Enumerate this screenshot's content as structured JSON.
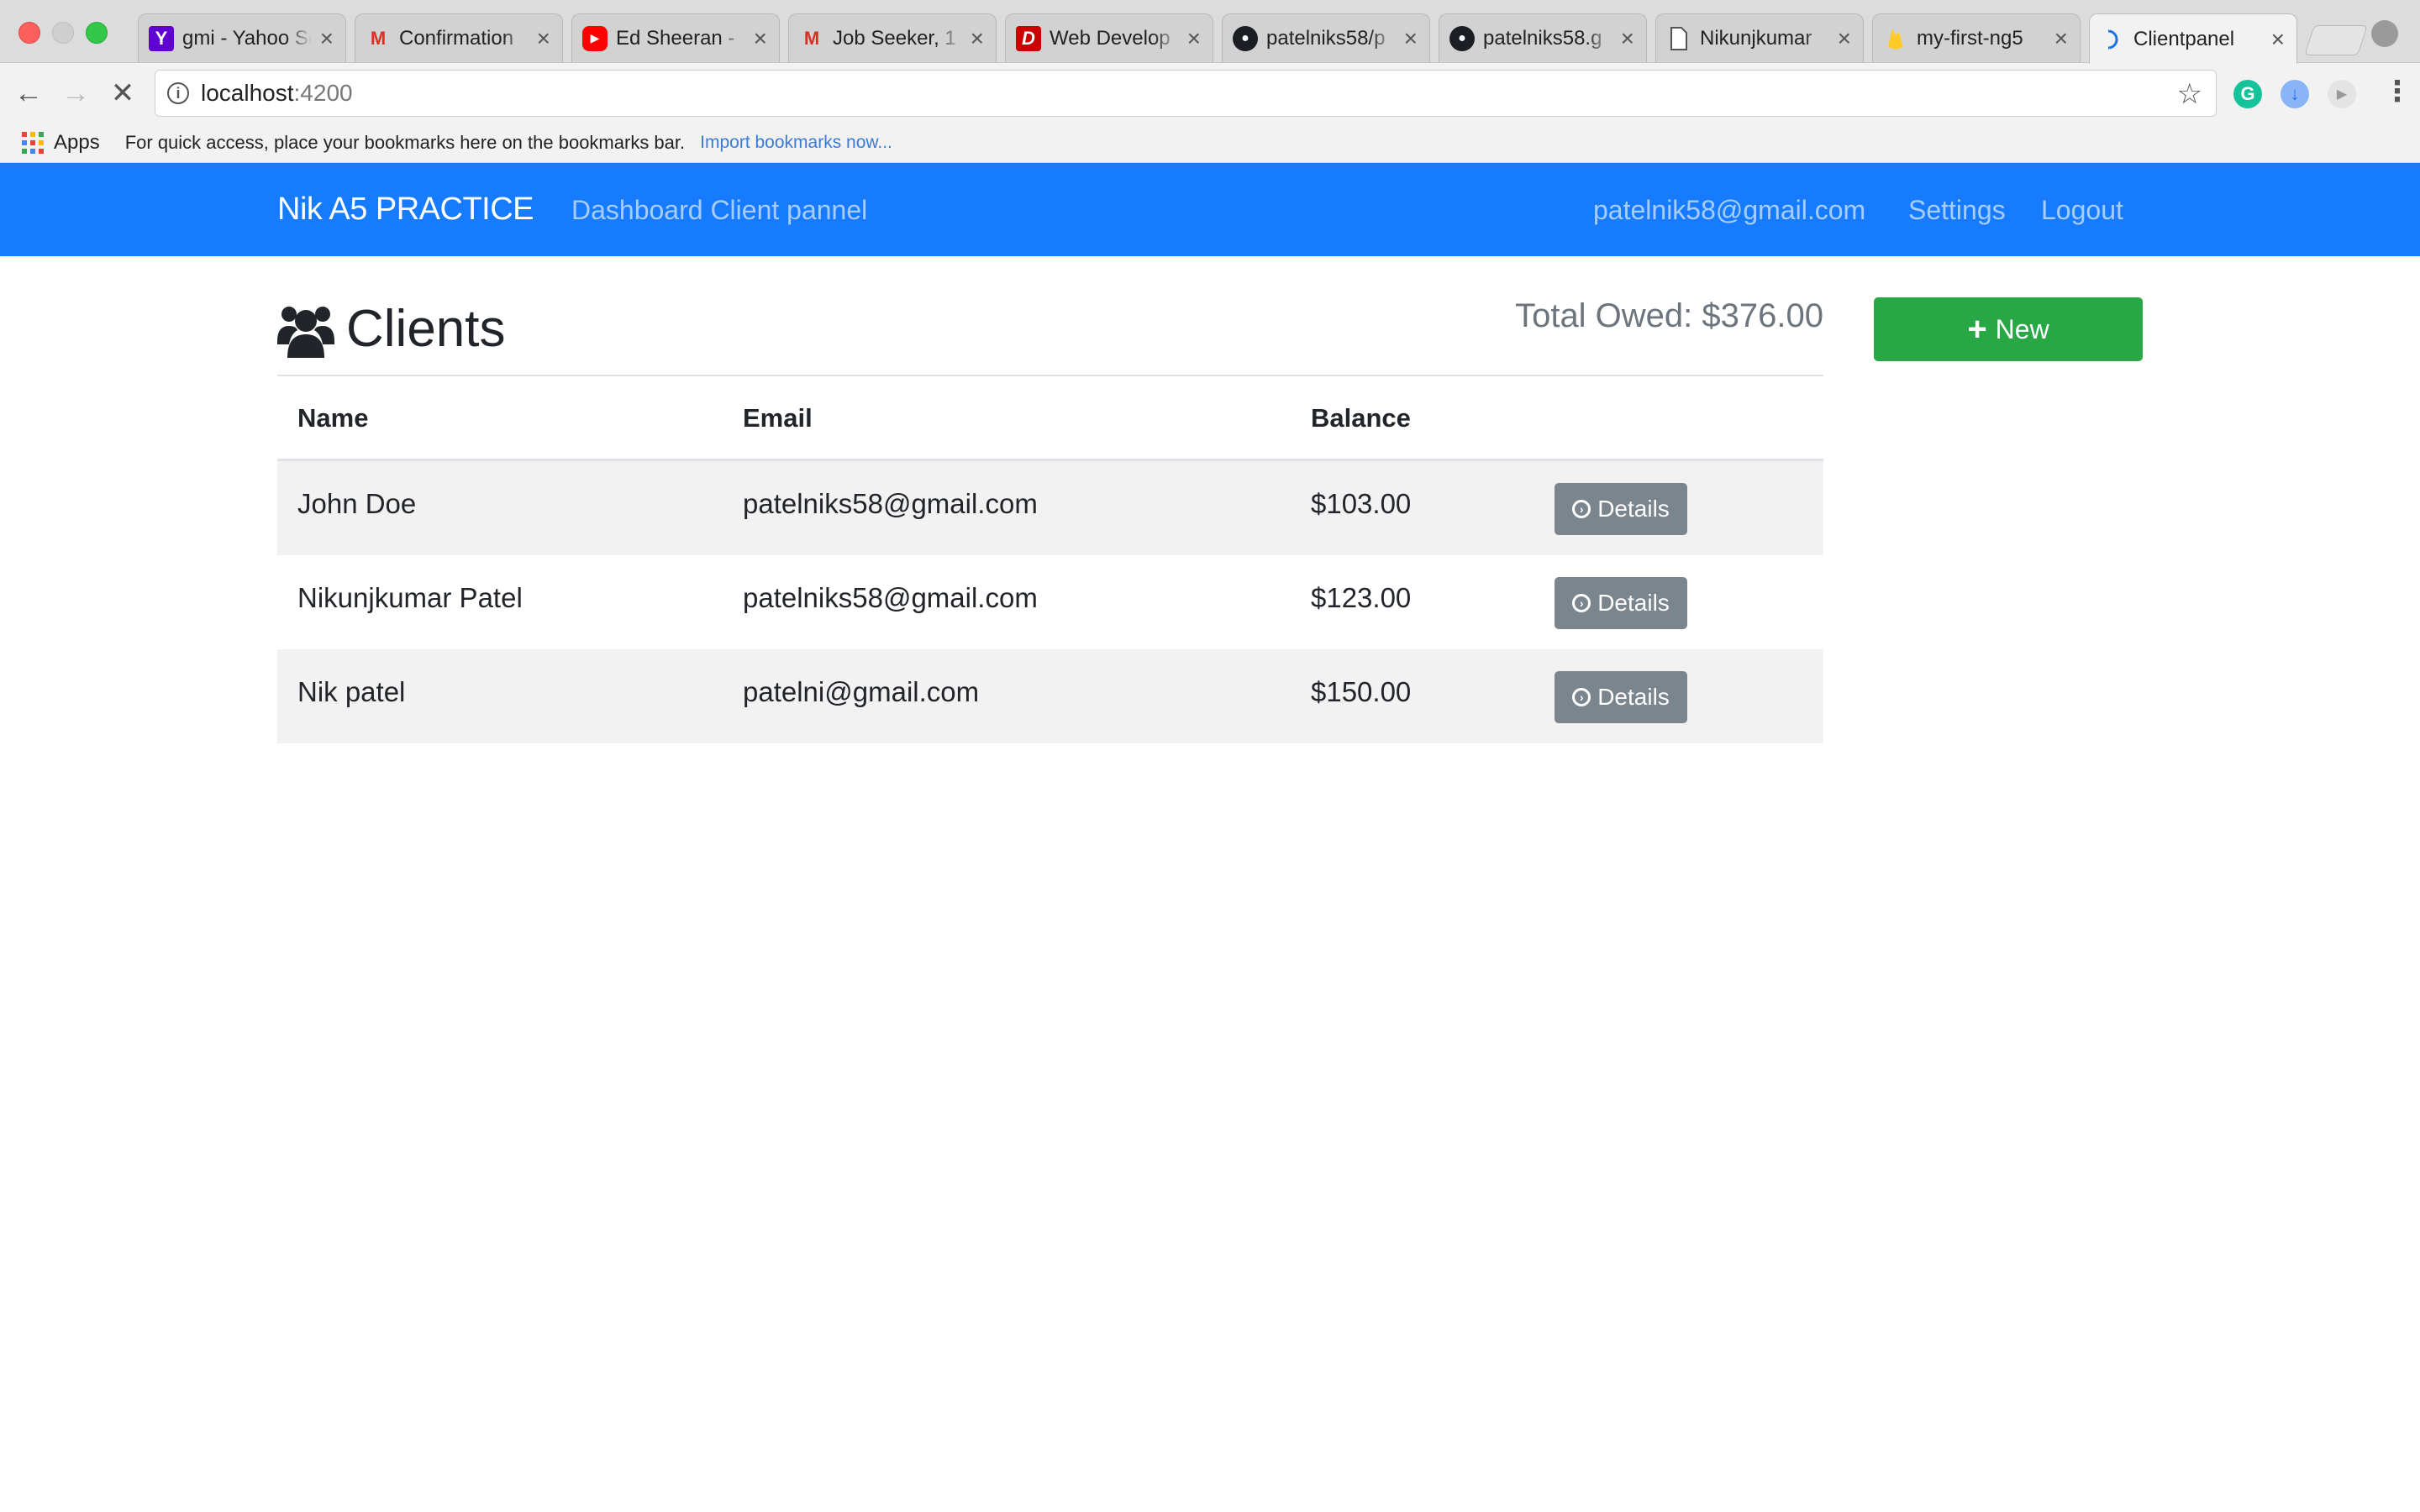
{
  "browser": {
    "tabs": [
      {
        "title": "gmi - Yahoo Search",
        "icon": "yahoo-icon",
        "active": false
      },
      {
        "title": "Confirmation",
        "icon": "gmail-icon",
        "active": false
      },
      {
        "title": "Ed Sheeran - ",
        "icon": "youtube-icon",
        "active": false
      },
      {
        "title": "Job Seeker, 1",
        "icon": "gmail-icon",
        "active": false
      },
      {
        "title": "Web Develop",
        "icon": "dice-icon",
        "active": false
      },
      {
        "title": "patelniks58/p",
        "icon": "github-icon",
        "active": false
      },
      {
        "title": "patelniks58.g",
        "icon": "github-icon",
        "active": false
      },
      {
        "title": "Nikunjkumar",
        "icon": "document-icon",
        "active": false
      },
      {
        "title": "my-first-ng5",
        "icon": "firebase-icon",
        "active": false
      },
      {
        "title": "Clientpanel",
        "icon": "loading-icon",
        "active": true
      }
    ],
    "close_glyph": "×",
    "url_host": "localhost",
    "url_port": ":4200",
    "bookmarks": {
      "apps_label": "Apps",
      "hint": "For quick access, place your bookmarks here on the bookmarks bar.",
      "import_link": "Import bookmarks now..."
    }
  },
  "navbar": {
    "brand": "Nik A5 PRACTICE",
    "dashboard": "Dashboard Client pannel",
    "user_email": "patelnik58@gmail.com",
    "settings": "Settings",
    "logout": "Logout"
  },
  "page": {
    "title": "Clients",
    "total_owed": "Total Owed: $376.00",
    "new_button": "New"
  },
  "table": {
    "headers": {
      "name": "Name",
      "email": "Email",
      "balance": "Balance"
    },
    "details_label": "Details",
    "rows": [
      {
        "name": "John Doe",
        "email": "patelniks58@gmail.com",
        "balance": "$103.00"
      },
      {
        "name": "Nikunjkumar Patel",
        "email": "patelniks58@gmail.com",
        "balance": "$123.00"
      },
      {
        "name": "Nik patel",
        "email": "patelni@gmail.com",
        "balance": "$150.00"
      }
    ]
  },
  "colors": {
    "navbar": "#167bff",
    "new_button": "#28a745",
    "details_button": "#7b858e",
    "row_stripe": "#f2f2f2"
  }
}
